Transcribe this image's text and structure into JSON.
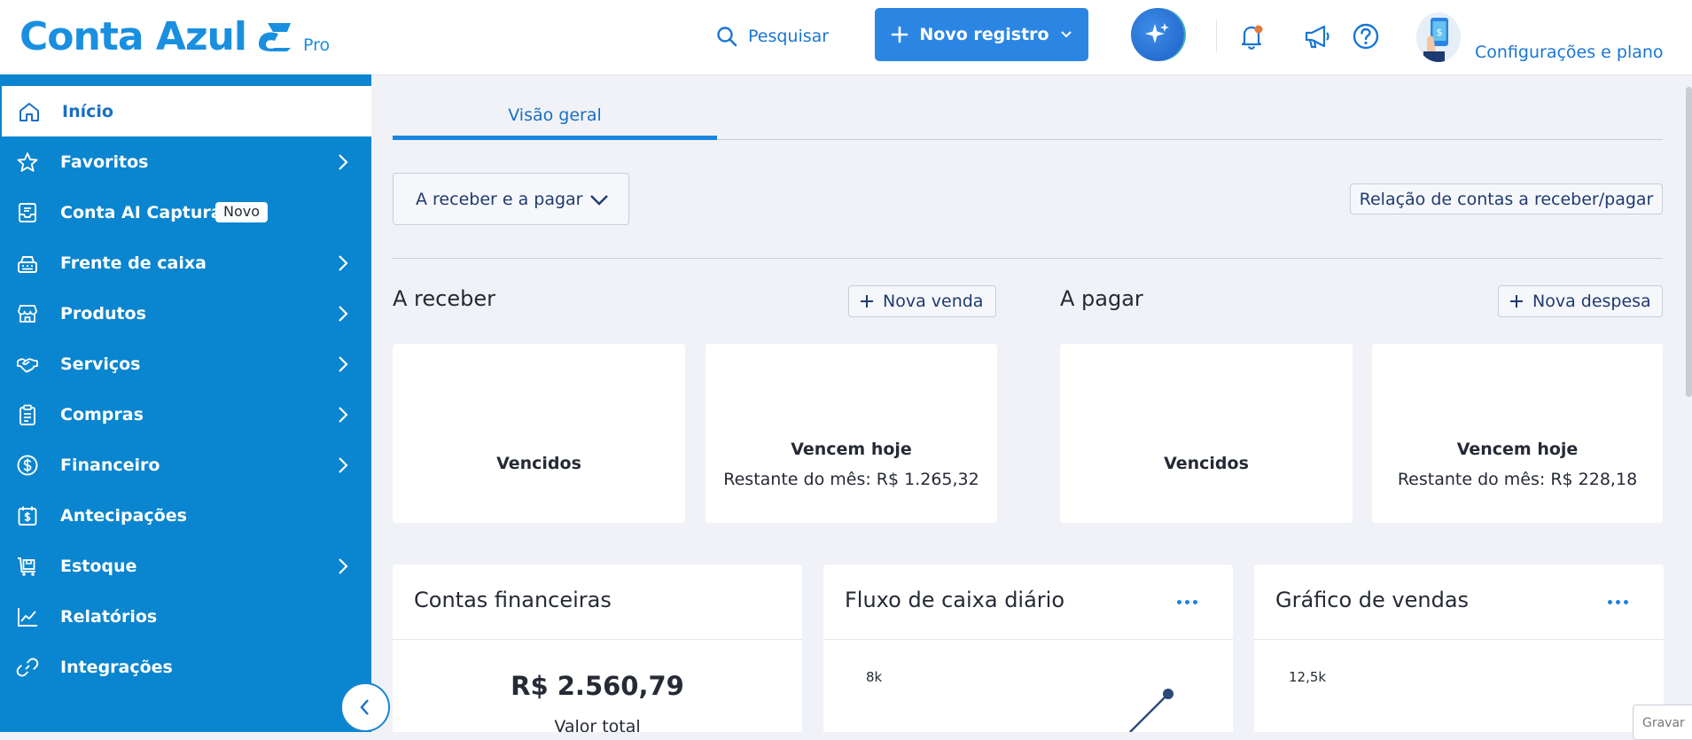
{
  "header": {
    "logo_text": "Conta Azul",
    "logo_plan": "Pro",
    "search_label": "Pesquisar",
    "new_record_label": "Novo registro",
    "config_label": "Configurações e plano",
    "icons": [
      "search-icon",
      "plus-icon",
      "chevron-down-icon",
      "sparkles-icon",
      "bell-icon",
      "megaphone-icon",
      "help-icon",
      "avatar-icon"
    ],
    "accent_color": "#2b86e3",
    "notification_dot_color": "#e8793a"
  },
  "sidebar": {
    "bg_color": "#0a85cf",
    "items": [
      {
        "label": "Início",
        "icon": "home-icon",
        "active": true
      },
      {
        "label": "Favoritos",
        "icon": "star-icon",
        "chevron": true
      },
      {
        "label": "Conta AI Captura",
        "icon": "inbox-icon",
        "badge": "Novo"
      },
      {
        "label": "Frente de caixa",
        "icon": "cash-register-icon",
        "chevron": true
      },
      {
        "label": "Produtos",
        "icon": "store-icon",
        "chevron": true
      },
      {
        "label": "Serviços",
        "icon": "handshake-icon",
        "chevron": true
      },
      {
        "label": "Compras",
        "icon": "clipboard-icon",
        "chevron": true
      },
      {
        "label": "Financeiro",
        "icon": "dollar-circle-icon",
        "chevron": true
      },
      {
        "label": "Antecipações",
        "icon": "calendar-dollar-icon"
      },
      {
        "label": "Estoque",
        "icon": "cart-icon",
        "chevron": true
      },
      {
        "label": "Relatórios",
        "icon": "line-chart-icon"
      },
      {
        "label": "Integrações",
        "icon": "link-icon"
      }
    ]
  },
  "main": {
    "tab_label": "Visão geral",
    "filter_label": "A receber e a pagar",
    "relation_button": "Relação de contas a receber/pagar",
    "receivable": {
      "title": "A receber",
      "action": "Nova venda",
      "cards": [
        {
          "title": "Vencidos"
        },
        {
          "title": "Vencem hoje",
          "subtitle": "Restante do mês: R$ 1.265,32"
        }
      ]
    },
    "payable": {
      "title": "A pagar",
      "action": "Nova despesa",
      "cards": [
        {
          "title": "Vencidos"
        },
        {
          "title": "Vencem hoje",
          "subtitle": "Restante do mês: R$ 228,18"
        }
      ]
    },
    "panels": [
      {
        "title": "Contas financeiras",
        "value": "R$ 2.560,79",
        "value_label": "Valor total"
      },
      {
        "title": "Fluxo de caixa diário",
        "tick": "8k"
      },
      {
        "title": "Gráfico de vendas",
        "tick": "12,5k"
      }
    ],
    "record_button": "Gravar"
  }
}
